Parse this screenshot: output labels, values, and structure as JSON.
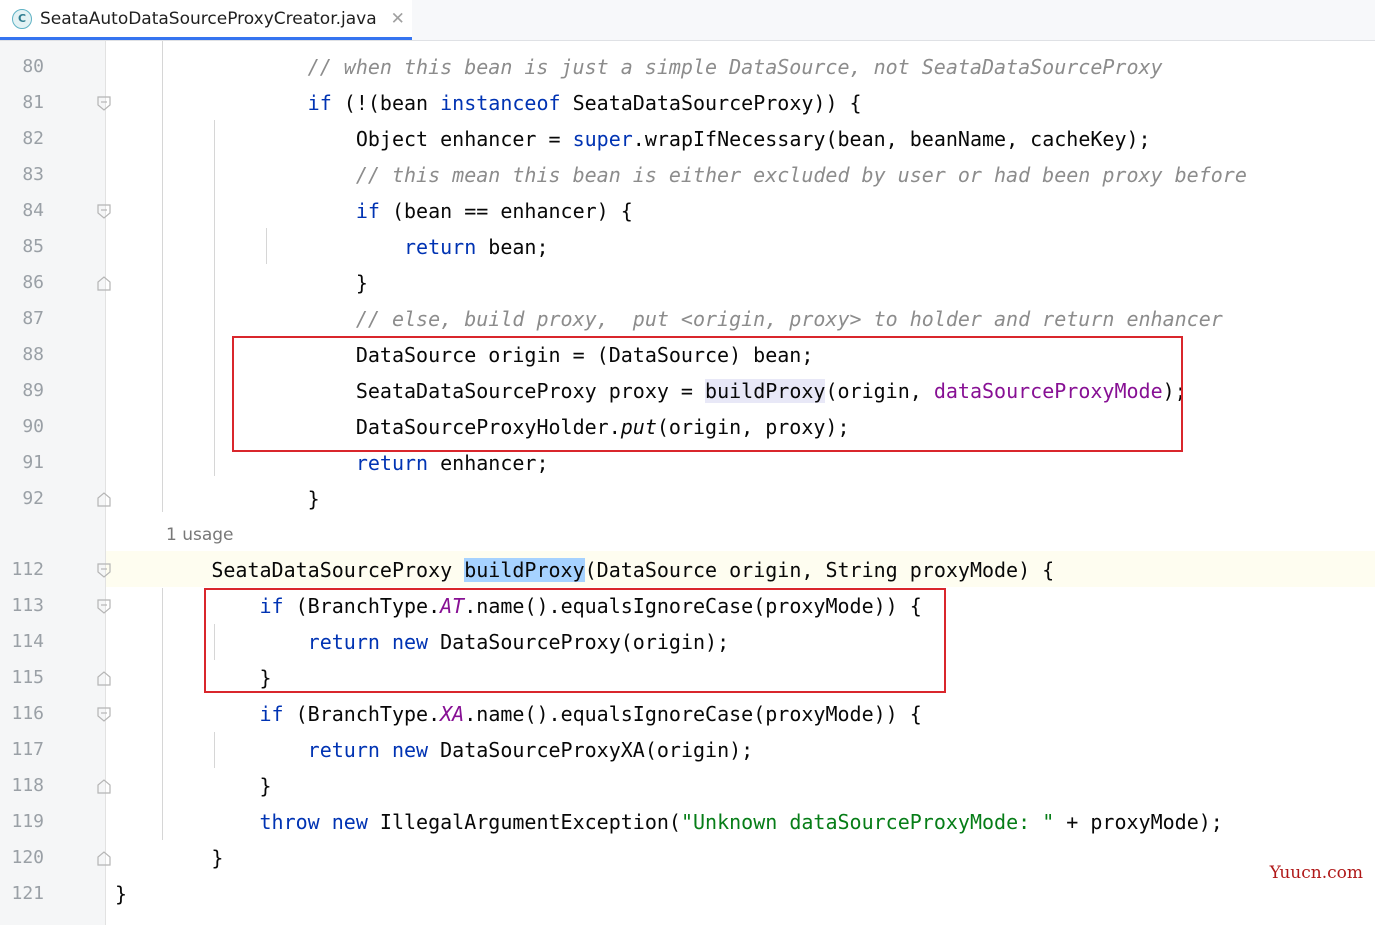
{
  "tab": {
    "title": "SeataAutoDataSourceProxyCreator.java",
    "icon_letter": "C",
    "close_glyph": "✕"
  },
  "usage_hint": "1 usage",
  "watermark": "Yuucn.com",
  "lines": {
    "l80": {
      "num": "80",
      "comment": "// when this bean is just a simple DataSource, not SeataDataSourceProxy"
    },
    "l81": {
      "num": "81",
      "kw_if": "if",
      "p1": " (!(bean ",
      "kw_instanceof": "instanceof",
      "p2": " SeataDataSourceProxy)) {"
    },
    "l82": {
      "num": "82",
      "p1": "Object enhancer = ",
      "kw_super": "super",
      "p2": ".wrapIfNecessary(bean, beanName, cacheKey);"
    },
    "l83": {
      "num": "83",
      "comment": "// this mean this bean is either excluded by user or had been proxy before"
    },
    "l84": {
      "num": "84",
      "kw_if": "if",
      "p1": " (bean == enhancer) {"
    },
    "l85": {
      "num": "85",
      "kw_return": "return",
      "p1": " bean;"
    },
    "l86": {
      "num": "86",
      "p1": "}"
    },
    "l87": {
      "num": "87",
      "comment": "// else, build proxy,  put <origin, proxy> to holder and return enhancer"
    },
    "l88": {
      "num": "88",
      "p1": "DataSource origin = (DataSource) bean;"
    },
    "l89": {
      "num": "89",
      "p1": "SeataDataSourceProxy proxy = ",
      "method": "buildProxy",
      "p2": "(origin, ",
      "field": "dataSourceProxyMode",
      "p3": ");"
    },
    "l90": {
      "num": "90",
      "p1": "DataSourceProxyHolder.",
      "static_method": "put",
      "p2": "(origin, proxy);"
    },
    "l91": {
      "num": "91",
      "kw_return": "return",
      "p1": " enhancer;"
    },
    "l92": {
      "num": "92",
      "p1": "}"
    },
    "l112": {
      "num": "112",
      "p1": "SeataDataSourceProxy ",
      "method": "buildProxy",
      "p2": "(DataSource origin, String proxyMode) {"
    },
    "l113": {
      "num": "113",
      "kw_if": "if",
      "p1": " (BranchType.",
      "enum": "AT",
      "p2": ".name().equalsIgnoreCase(proxyMode)) {"
    },
    "l114": {
      "num": "114",
      "kw_return": "return",
      "kw_new": "new",
      "p1": " DataSourceProxy(origin);"
    },
    "l115": {
      "num": "115",
      "p1": "}"
    },
    "l116": {
      "num": "116",
      "kw_if": "if",
      "p1": " (BranchType.",
      "enum": "XA",
      "p2": ".name().equalsIgnoreCase(proxyMode)) {"
    },
    "l117": {
      "num": "117",
      "kw_return": "return",
      "kw_new": "new",
      "p1": " DataSourceProxyXA(origin);"
    },
    "l118": {
      "num": "118",
      "p1": "}"
    },
    "l119": {
      "num": "119",
      "kw_throw": "throw",
      "kw_new": "new",
      "p1": " IllegalArgumentException(",
      "string": "\"Unknown dataSourceProxyMode: \"",
      "p2": " + proxyMode);"
    },
    "l120": {
      "num": "120",
      "p1": "}"
    },
    "l121": {
      "num": "121",
      "p1": "}"
    }
  }
}
